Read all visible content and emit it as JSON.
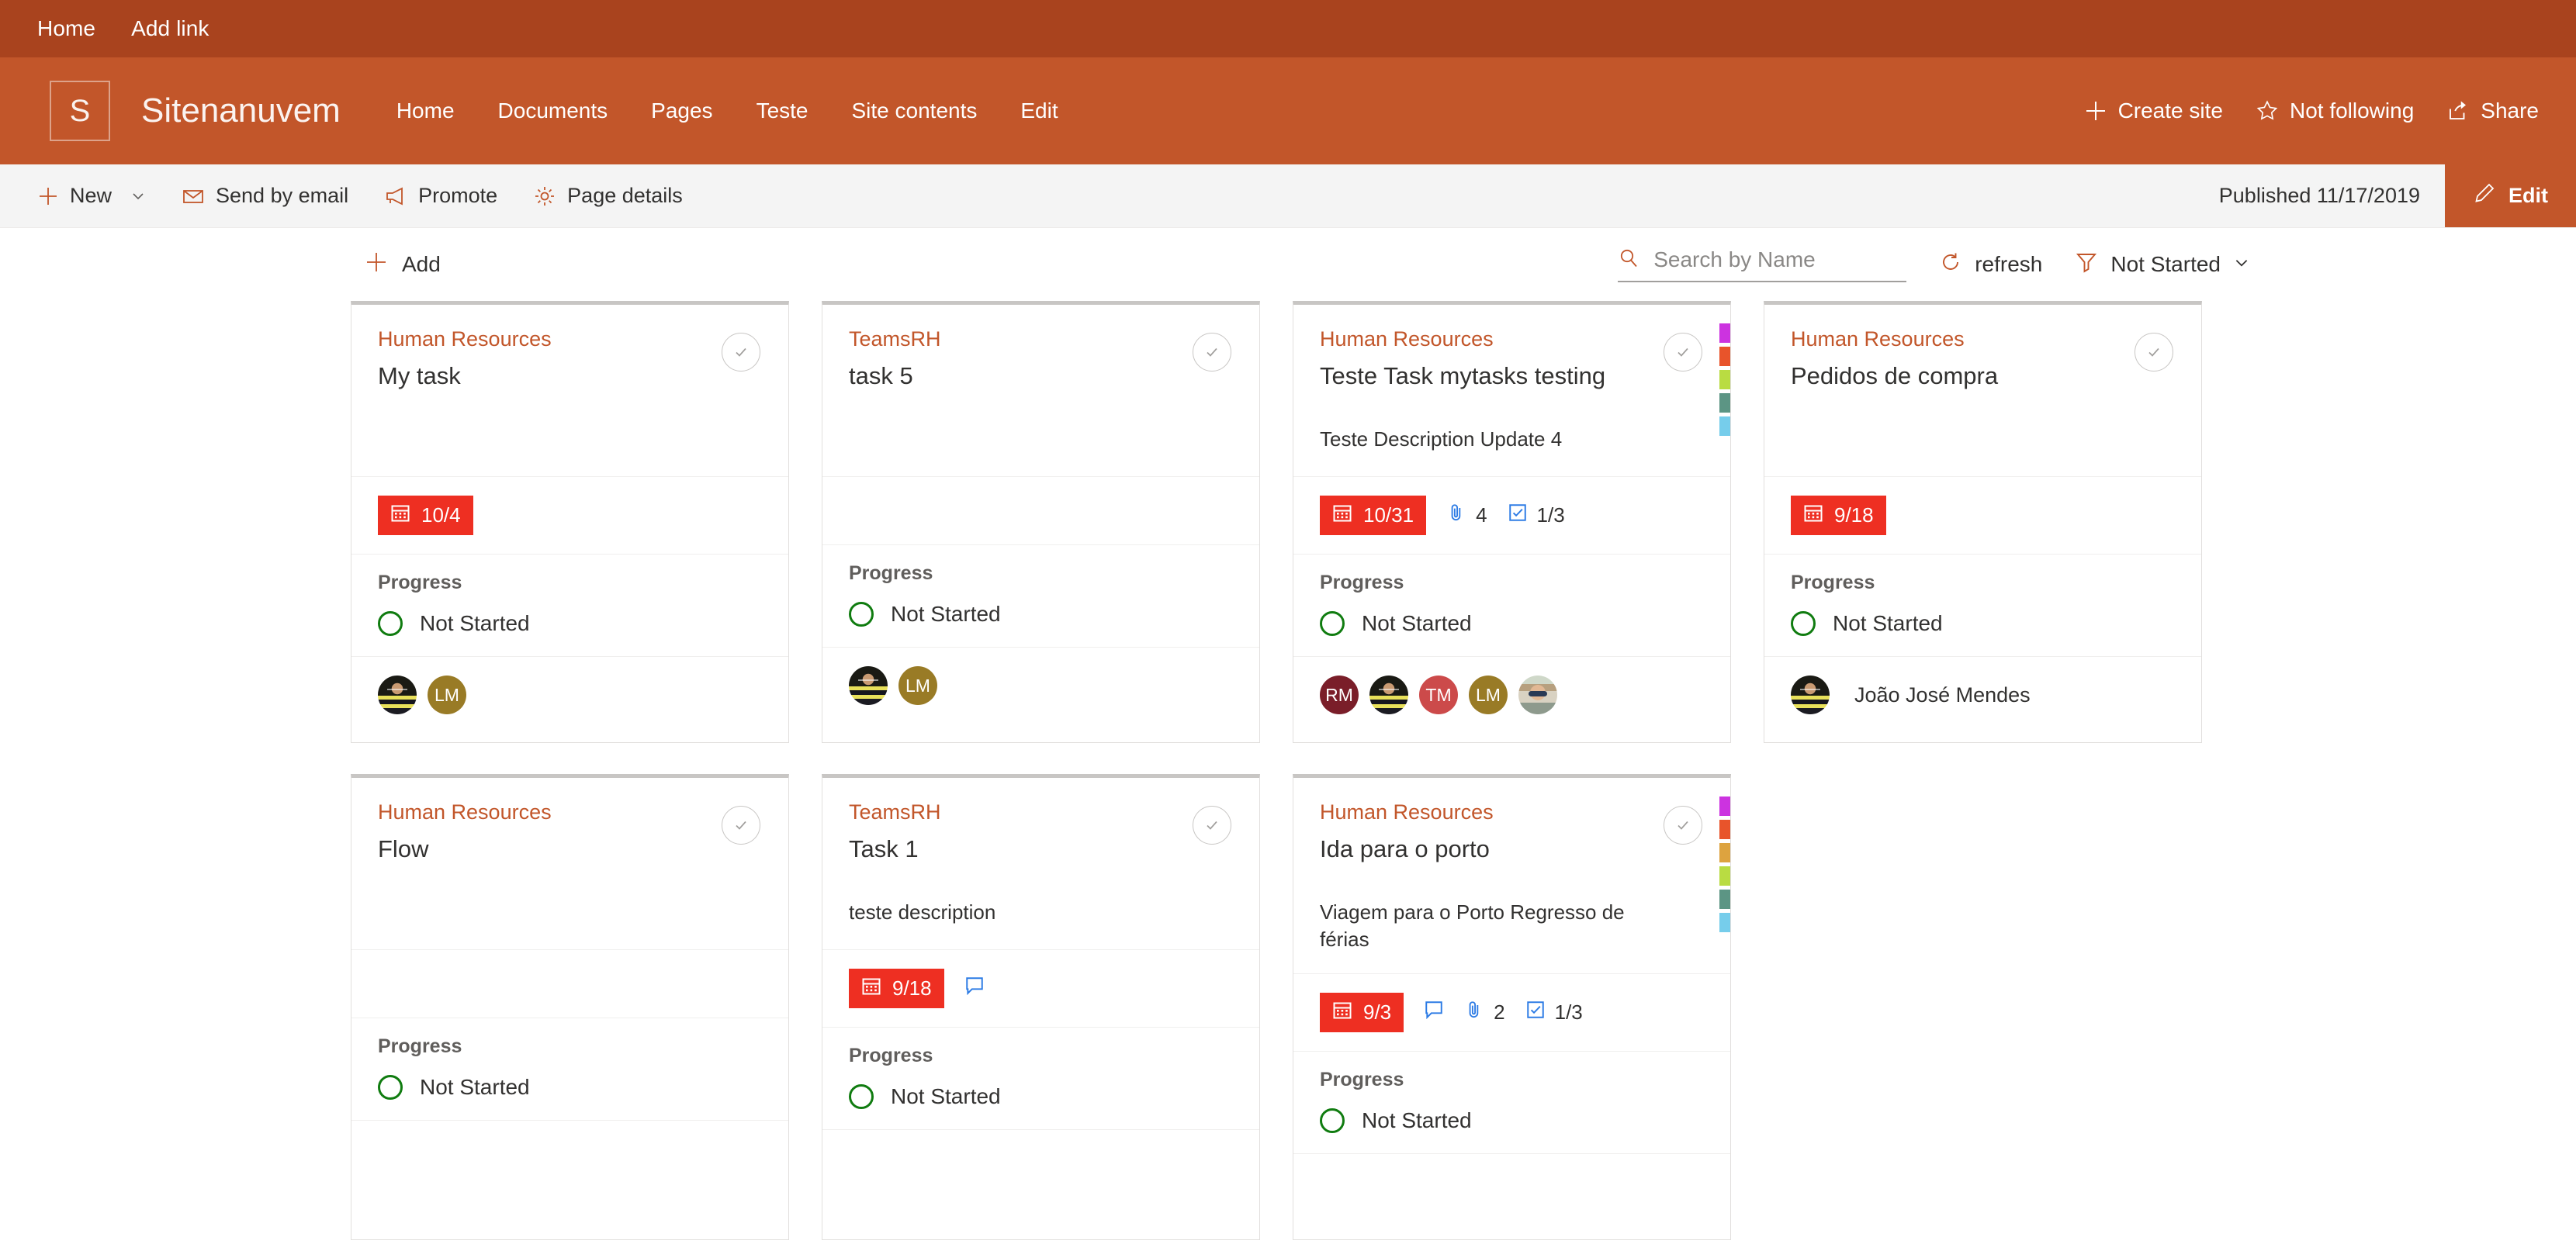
{
  "suite_bar": {
    "links": [
      {
        "label": "Home",
        "name": "suite-link-home"
      },
      {
        "label": "Add link",
        "name": "suite-link-add-link"
      }
    ],
    "background": "#A9431E"
  },
  "site_header": {
    "logo_letter": "S",
    "site_title": "Sitenanuvem",
    "background": "#C2562A",
    "nav": [
      {
        "label": "Home"
      },
      {
        "label": "Documents"
      },
      {
        "label": "Pages"
      },
      {
        "label": "Teste"
      },
      {
        "label": "Site contents"
      },
      {
        "label": "Edit"
      }
    ],
    "actions": [
      {
        "label": "Create site",
        "icon": "plus-icon"
      },
      {
        "label": "Not following",
        "icon": "star-icon"
      },
      {
        "label": "Share",
        "icon": "share-icon"
      }
    ]
  },
  "command_bar": {
    "items": [
      {
        "label": "New",
        "icon": "plus-icon",
        "has_chevron": true
      },
      {
        "label": "Send by email",
        "icon": "mail-icon",
        "has_chevron": false
      },
      {
        "label": "Promote",
        "icon": "megaphone-icon",
        "has_chevron": false
      },
      {
        "label": "Page details",
        "icon": "gear-icon",
        "has_chevron": false
      }
    ],
    "published_status": "Published 11/17/2019",
    "edit_label": "Edit"
  },
  "webpart_toolbar": {
    "add_label": "Add",
    "search_placeholder": "Search by Name",
    "search_value": "",
    "refresh_label": "refresh",
    "filter_label": "Not Started"
  },
  "accent_color": "#C2562A",
  "due_date_color": "#EE2F22",
  "progress_ring_color": "#107C10",
  "cards": [
    {
      "bucket": "Human Resources",
      "title": "My task",
      "description": "",
      "due_date": "10/4",
      "attachments": "",
      "comments": false,
      "checklist": "",
      "progress_label": "Progress",
      "progress_value": "Not Started",
      "stripes": [],
      "people": [
        {
          "type": "photo",
          "photo": "joao",
          "initials": "",
          "color": ""
        },
        {
          "type": "initials",
          "initials": "LM",
          "color": "#997B26"
        }
      ],
      "assignee_name": ""
    },
    {
      "bucket": "TeamsRH",
      "title": "task 5",
      "description": "",
      "due_date": "",
      "attachments": "",
      "comments": false,
      "checklist": "",
      "progress_label": "Progress",
      "progress_value": "Not Started",
      "stripes": [],
      "people": [
        {
          "type": "photo",
          "photo": "joao",
          "initials": "",
          "color": ""
        },
        {
          "type": "initials",
          "initials": "LM",
          "color": "#997B26"
        }
      ],
      "assignee_name": ""
    },
    {
      "bucket": "Human Resources",
      "title": "Teste Task mytasks testing",
      "description": "Teste Description Update 4",
      "due_date": "10/31",
      "attachments": "4",
      "comments": false,
      "checklist": "1/3",
      "progress_label": "Progress",
      "progress_value": "Not Started",
      "stripes": [
        "#CC33E0",
        "#E8542B",
        "#B9DC42",
        "#5C9584",
        "#76CDEB"
      ],
      "people": [
        {
          "type": "initials",
          "initials": "RM",
          "color": "#7A1E29"
        },
        {
          "type": "photo",
          "photo": "joao",
          "initials": "",
          "color": ""
        },
        {
          "type": "initials",
          "initials": "TM",
          "color": "#CC4A4A"
        },
        {
          "type": "initials",
          "initials": "LM",
          "color": "#997B26"
        },
        {
          "type": "photo",
          "photo": "woman",
          "initials": "",
          "color": ""
        }
      ],
      "assignee_name": ""
    },
    {
      "bucket": "Human Resources",
      "title": "Pedidos de compra",
      "description": "",
      "due_date": "9/18",
      "attachments": "",
      "comments": false,
      "checklist": "",
      "progress_label": "Progress",
      "progress_value": "Not Started",
      "stripes": [],
      "people": [
        {
          "type": "photo",
          "photo": "joao",
          "initials": "",
          "color": ""
        }
      ],
      "assignee_name": "João José Mendes"
    },
    {
      "bucket": "Human Resources",
      "title": "Flow",
      "description": "",
      "due_date": "",
      "attachments": "",
      "comments": false,
      "checklist": "",
      "progress_label": "Progress",
      "progress_value": "Not Started",
      "stripes": [],
      "people": [],
      "assignee_name": ""
    },
    {
      "bucket": "TeamsRH",
      "title": "Task 1",
      "description": "teste description",
      "due_date": "9/18",
      "attachments": "",
      "comments": true,
      "checklist": "",
      "progress_label": "Progress",
      "progress_value": "Not Started",
      "stripes": [],
      "people": [],
      "assignee_name": ""
    },
    {
      "bucket": "Human Resources",
      "title": "Ida para o porto",
      "description": "Viagem para o Porto Regresso de férias",
      "due_date": "9/3",
      "attachments": "2",
      "comments": true,
      "checklist": "1/3",
      "progress_label": "Progress",
      "progress_value": "Not Started",
      "stripes": [
        "#CC33E0",
        "#E8542B",
        "#DDA33F",
        "#B9DC42",
        "#5C9584",
        "#76CDEB"
      ],
      "people": [],
      "assignee_name": ""
    }
  ]
}
